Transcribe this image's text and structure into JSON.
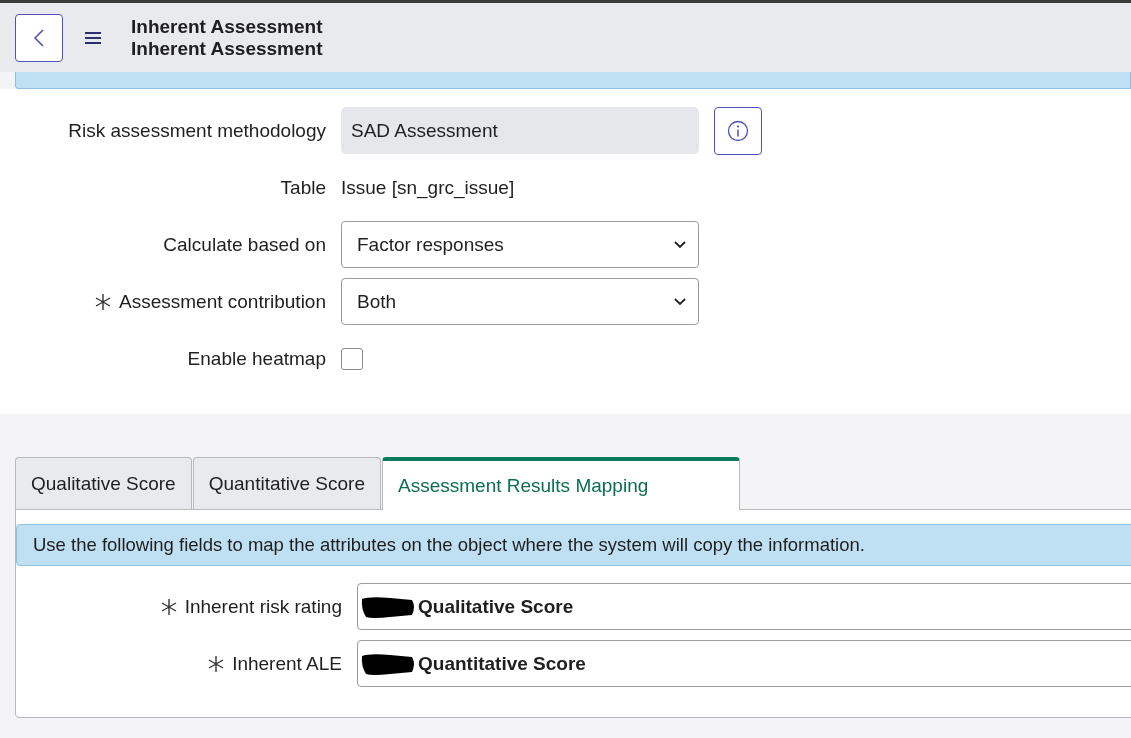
{
  "header": {
    "title": "Inherent Assessment",
    "subtitle": "Inherent Assessment"
  },
  "form": [
    {
      "kind": "readonly",
      "label": "Risk assessment methodology",
      "value": "SAD Assessment",
      "required": false,
      "info": true
    },
    {
      "kind": "text",
      "label": "Table",
      "value": "Issue [sn_grc_issue]",
      "required": false,
      "info": false
    },
    {
      "kind": "select",
      "label": "Calculate based on",
      "value": "Factor responses",
      "required": false,
      "info": false
    },
    {
      "kind": "select",
      "label": "Assessment contribution",
      "value": "Both",
      "required": true,
      "info": false
    },
    {
      "kind": "checkbox",
      "label": "Enable heatmap",
      "checked": false,
      "required": false,
      "info": false
    }
  ],
  "tabs": [
    {
      "label": "Qualitative Score",
      "selected": false
    },
    {
      "label": "Quantitative Score",
      "selected": false
    },
    {
      "label": "Assessment Results Mapping",
      "selected": true
    }
  ],
  "mapping": {
    "message": "Use the following fields to map the attributes on the object where the system will copy the information.",
    "fields": [
      {
        "label": "Inherent risk rating",
        "value": "Qualitative Score",
        "required": true
      },
      {
        "label": "Inherent ALE",
        "value": "Quantitative Score",
        "required": true
      }
    ]
  }
}
